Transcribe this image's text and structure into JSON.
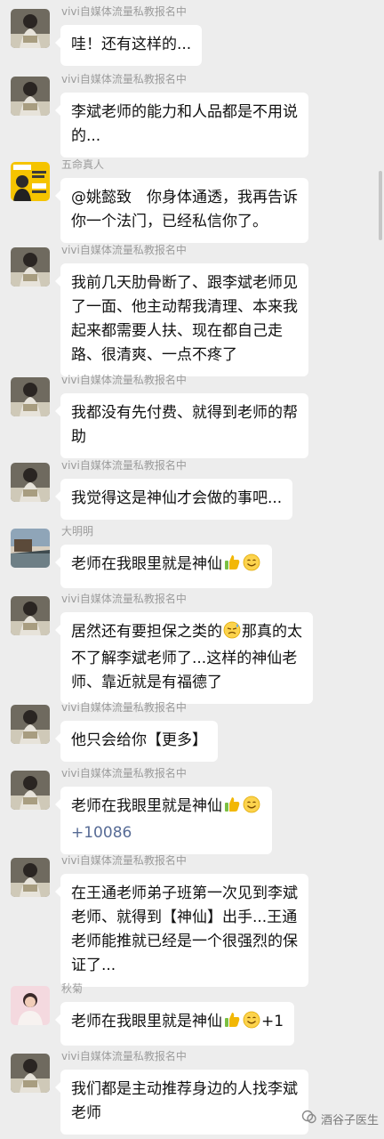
{
  "messages": [
    {
      "sender": "vivi自媒体流量私教报名中",
      "avatar": "woman-reading-avatar",
      "lines": [
        "哇！还有这样的..."
      ]
    },
    {
      "sender": "vivi自媒体流量私教报名中",
      "avatar": "woman-reading-avatar",
      "lines": [
        "李斌老师的能力和人品都是不用说",
        "的..."
      ]
    },
    {
      "sender": "五命真人",
      "avatar": "book-poster-avatar",
      "lines": [
        "@姚懿致　你身体通透，我再告诉",
        "你一个法门，已经私信你了。"
      ]
    },
    {
      "sender": "vivi自媒体流量私教报名中",
      "avatar": "woman-reading-avatar",
      "lines": [
        "我前几天肋骨断了、跟李斌老师见",
        "了一面、他主动帮我清理、本来我",
        "起来都需要人扶、现在都自己走",
        "路、很清爽、一点不疼了"
      ]
    },
    {
      "sender": "vivi自媒体流量私教报名中",
      "avatar": "woman-reading-avatar",
      "lines": [
        "我都没有先付费、就得到老师的帮",
        "助"
      ]
    },
    {
      "sender": "vivi自媒体流量私教报名中",
      "avatar": "woman-reading-avatar",
      "lines": [
        "我觉得这是神仙才会做的事吧..."
      ]
    },
    {
      "sender": "大明明",
      "avatar": "landscape-avatar",
      "lines": [
        "老师在我眼里就是神仙"
      ],
      "emoji_after": [
        "thumbs-up-emoji",
        "smile-emoji"
      ]
    },
    {
      "sender": "vivi自媒体流量私教报名中",
      "avatar": "woman-reading-avatar",
      "lines": [
        "居然还有要担保之类的",
        "不了解李斌老师了...这样的神仙老",
        "师、靠近就是有福德了"
      ],
      "line1_emoji": "sweat-emoji",
      "line1_rest": "那真的太"
    },
    {
      "sender": "vivi自媒体流量私教报名中",
      "avatar": "woman-reading-avatar",
      "lines": [
        "他只会给你【更多】"
      ]
    },
    {
      "sender": "vivi自媒体流量私教报名中",
      "avatar": "woman-reading-avatar",
      "lines": [
        "老师在我眼里就是神仙"
      ],
      "emoji_after": [
        "thumbs-up-emoji",
        "smile-emoji"
      ],
      "second_line": "+10086"
    },
    {
      "sender": "vivi自媒体流量私教报名中",
      "avatar": "woman-reading-avatar",
      "lines": [
        "在王通老师弟子班第一次见到李斌",
        "老师、就得到【神仙】出手...王通",
        "老师能推就已经是一个很强烈的保",
        "证了..."
      ]
    },
    {
      "sender": "秋菊",
      "avatar": "pink-portrait-avatar",
      "lines": [
        "老师在我眼里就是神仙"
      ],
      "emoji_after": [
        "thumbs-up-emoji",
        "smile-emoji"
      ],
      "trail": "+1"
    },
    {
      "sender": "vivi自媒体流量私教报名中",
      "avatar": "woman-reading-avatar",
      "lines": [
        "我们都是主动推荐身边的人找李斌",
        "老师"
      ]
    }
  ],
  "watermark": {
    "label": "酒谷子医生"
  }
}
